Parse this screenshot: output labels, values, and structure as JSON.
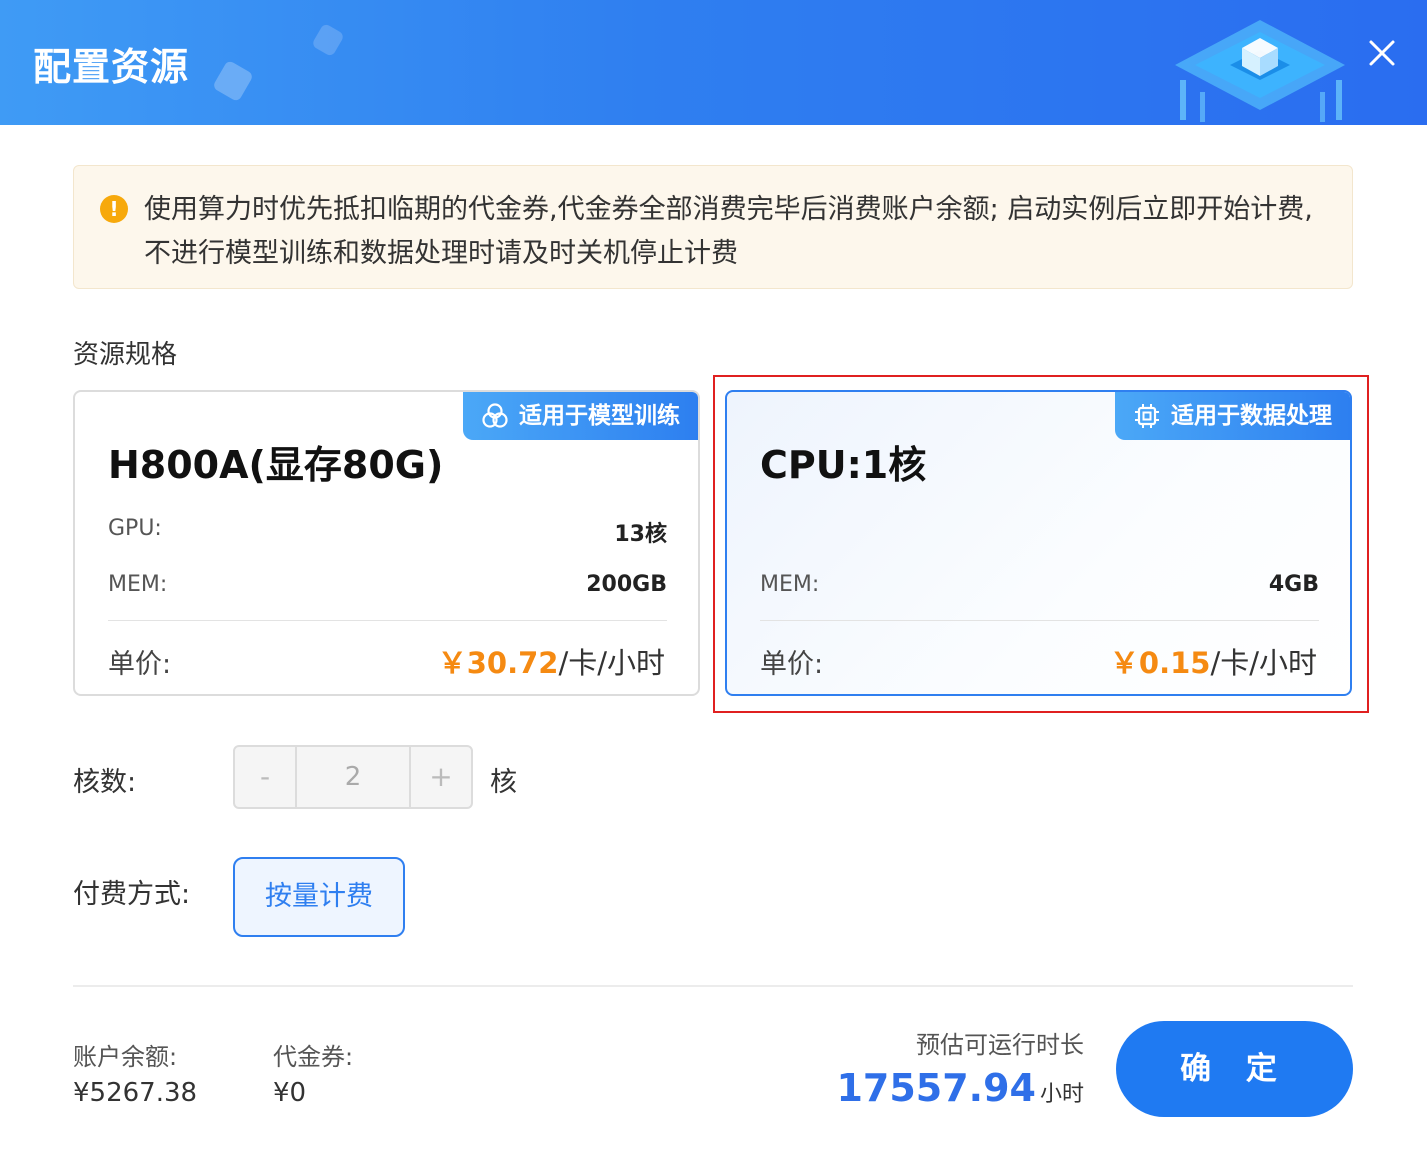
{
  "dialog": {
    "title": "配置资源"
  },
  "notice": {
    "text": "使用算力时优先抵扣临期的代金券,代金券全部消费完毕后消费账户余额; 启动实例后立即开始计费,不进行模型训练和数据处理时请及时关机停止计费",
    "icon": "warning-icon"
  },
  "resource": {
    "section_label": "资源规格",
    "cards": [
      {
        "tag": "适用于模型训练",
        "tag_icon": "training-icon",
        "title": "H800A(显存80G)",
        "specs": [
          {
            "label": "GPU:",
            "value": "13核"
          },
          {
            "label": "MEM:",
            "value": "200GB"
          }
        ],
        "price_label": "单价:",
        "price_amount": "￥30.72",
        "price_unit": "/卡/小时"
      },
      {
        "tag": "适用于数据处理",
        "tag_icon": "chip-icon",
        "title": "CPU:1核",
        "specs": [
          {
            "label": "MEM:",
            "value": "4GB"
          }
        ],
        "price_label": "单价:",
        "price_amount": "￥0.15",
        "price_unit": "/卡/小时",
        "selected": true
      }
    ]
  },
  "cores": {
    "label": "核数:",
    "minus": "-",
    "value": "2",
    "plus": "+",
    "unit": "核"
  },
  "payment": {
    "label": "付费方式:",
    "option": "按量计费"
  },
  "footer": {
    "balance_label": "账户余额:",
    "balance_value": "¥5267.38",
    "voucher_label": "代金券:",
    "voucher_value": "¥0",
    "estimate_label": "预估可运行时长",
    "estimate_value": "17557.94",
    "estimate_unit": "小时",
    "confirm": "确 定"
  },
  "colors": {
    "primary": "#2f7ff0",
    "price": "#f58a12",
    "warning": "#f7a90c",
    "highlight": "#e02020"
  }
}
